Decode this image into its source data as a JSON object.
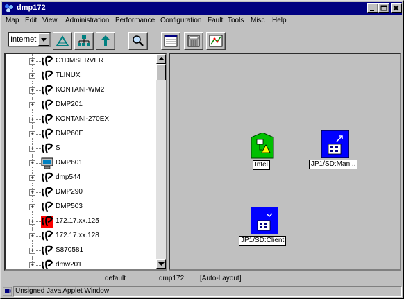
{
  "window": {
    "title": "dmp172"
  },
  "menu": [
    "Map",
    "Edit",
    "View",
    "Administration",
    "Performance",
    "Configuration",
    "Fault",
    "Tools",
    "Misc",
    "Help"
  ],
  "toolbar": {
    "domain_select": "Internet"
  },
  "tree": {
    "items": [
      {
        "label": "C1DMSERVER",
        "icon": "host-icon"
      },
      {
        "label": "TLINUX",
        "icon": "host-icon"
      },
      {
        "label": "KONTANI-WM2",
        "icon": "host-icon"
      },
      {
        "label": "DMP201",
        "icon": "host-icon"
      },
      {
        "label": "KONTANI-270EX",
        "icon": "host-icon"
      },
      {
        "label": "DMP60E",
        "icon": "host-icon"
      },
      {
        "label": "S",
        "icon": "host-icon"
      },
      {
        "label": "DMP601",
        "icon": "monitor-icon"
      },
      {
        "label": "dmp544",
        "icon": "host-icon"
      },
      {
        "label": "DMP290",
        "icon": "host-icon"
      },
      {
        "label": "DMP503",
        "icon": "host-icon"
      },
      {
        "label": "172.17.xx.125",
        "icon": "host-alert-icon"
      },
      {
        "label": "172.17.xx.128",
        "icon": "host-icon"
      },
      {
        "label": "S870581",
        "icon": "host-icon"
      },
      {
        "label": "dmw201",
        "icon": "host-icon"
      }
    ]
  },
  "map": {
    "objects": [
      {
        "label": "Intel",
        "icon": "network-segment-icon",
        "color": "#00c000"
      },
      {
        "label": "JP1/SD:Man...",
        "icon": "jp1-manager-icon",
        "color": "#0000ff"
      },
      {
        "label": "JP1/SD:Client",
        "icon": "jp1-client-icon",
        "color": "#0000ff"
      }
    ]
  },
  "status": {
    "left": "default",
    "center": "dmp172",
    "right": "[Auto-Layout]"
  },
  "applet": {
    "warning": "Unsigned Java Applet Window"
  }
}
